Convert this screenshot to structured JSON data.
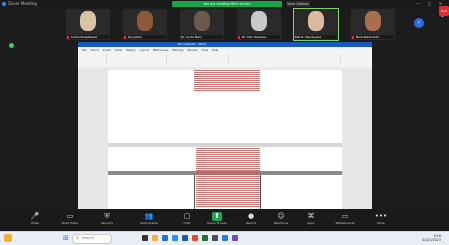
{
  "window": {
    "title": "Zoom Meeting"
  },
  "share_banner": {
    "text": "You are viewing Mia's screen",
    "stop": "View Options"
  },
  "gallery": {
    "participants": [
      {
        "name": "Indira Puspitasari",
        "face_color": "#d8c3a4",
        "muted": true
      },
      {
        "name": "Ibu Julian",
        "face_color": "#8a5a3a",
        "muted": true
      },
      {
        "name": "Dr. Andri Bani",
        "face_color": "#6b5a4a",
        "muted": false
      },
      {
        "name": "Dr. Hari Santoso",
        "face_color": "#c9c9c9",
        "muted": true
      },
      {
        "name": "Mia R. Hendayani",
        "face_color": "#d9b9a0",
        "muted": false,
        "active": true
      },
      {
        "name": "Budi Rahmanto",
        "face_color": "#a86e4e",
        "muted": true
      }
    ],
    "next_icon": "chevron-right-icon"
  },
  "shared_doc": {
    "app": "Word",
    "title": "Document1 - Word"
  },
  "ribbon": {
    "tabs": "File Home Insert Draw Design Layout References Mailings Review View Help"
  },
  "toolbar": {
    "items": [
      {
        "label": "Mute",
        "icon": "🎤"
      },
      {
        "label": "Start Video",
        "icon": "▭"
      },
      {
        "label": "Security",
        "icon": "⛨"
      },
      {
        "label": "Participants",
        "icon": "👥"
      },
      {
        "label": "Chat",
        "icon": "▢"
      },
      {
        "label": "Share Screen",
        "icon": "⬆",
        "green": true
      },
      {
        "label": "Record",
        "icon": "●"
      },
      {
        "label": "Reactions",
        "icon": "☺"
      },
      {
        "label": "Apps",
        "icon": "⌘"
      },
      {
        "label": "Whiteboards",
        "icon": "▭"
      },
      {
        "label": "More",
        "icon": "•••"
      }
    ],
    "leave": "End"
  },
  "taskbar": {
    "search": "Search",
    "time": "9:18",
    "date": "02/03/2023"
  }
}
